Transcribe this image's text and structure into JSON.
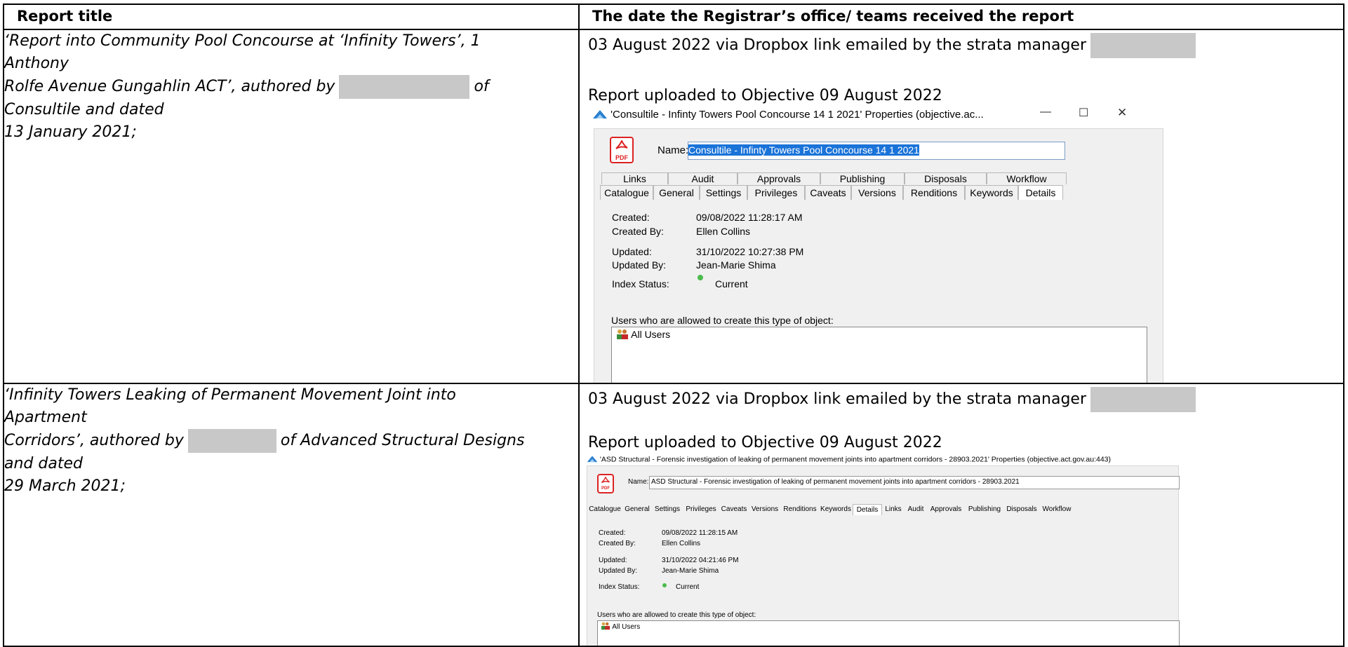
{
  "table": {
    "headers": [
      "Report title",
      "The date the Registrar’s office/ teams received the report"
    ]
  },
  "rows": [
    {
      "title_lines": [
        "‘Report into Community Pool Concourse at ‘Infinity Towers’, 1",
        "Anthony",
        "Rolfe Avenue Gungahlin ACT’, authored by",
        "of",
        "Consultile and dated",
        "13 January 2021;"
      ],
      "received": "03 August 2022 via Dropbox link emailed by the strata manager",
      "uploaded": "Report uploaded to Objective 09 August 2022",
      "props": {
        "window_title": "'Consultile - Infinty Towers Pool Concourse 14 1 2021' Properties (objective.ac...",
        "name_label": "Name:",
        "name_value": "Consultile - Infinty Towers Pool Concourse 14 1 2021",
        "pdf_label": "PDF",
        "tabs_row1": [
          "Links",
          "Audit",
          "Approvals",
          "Publishing",
          "Disposals",
          "Workflow"
        ],
        "tabs_row2": [
          "Catalogue",
          "General",
          "Settings",
          "Privileges",
          "Caveats",
          "Versions",
          "Renditions",
          "Keywords",
          "Details"
        ],
        "active_tab": "Details",
        "created_label": "Created:",
        "created": "09/08/2022 11:28:17 AM",
        "created_by_label": "Created By:",
        "created_by": "Ellen Collins",
        "updated_label": "Updated:",
        "updated": "31/10/2022 10:27:38 PM",
        "updated_by_label": "Updated By:",
        "updated_by": "Jean-Marie Shima",
        "index_status_label": "Index Status:",
        "index_status": "Current",
        "users_label": "Users who are allowed to create this type of object:",
        "users_value": "All Users",
        "minimize": "—",
        "maximize": "☐",
        "close": "✕"
      }
    },
    {
      "title_lines": [
        "‘Infinity Towers Leaking of Permanent Movement Joint into",
        "Apartment",
        "Corridors’, authored by",
        "of Advanced Structural Designs",
        "and dated",
        "29 March 2021;"
      ],
      "received": "03 August 2022 via Dropbox link emailed by the strata manager",
      "uploaded": "Report uploaded to Objective 09 August 2022",
      "props": {
        "window_title": "'ASD Structural - Forensic investigation of leaking of permanent movement joints into apartment corridors - 28903.2021' Properties (objective.act.gov.au:443)",
        "name_label": "Name:",
        "name_value": "ASD Structural - Forensic investigation of leaking of permanent movement joints into apartment corridors - 28903.2021",
        "pdf_label": "PDF",
        "tabs": [
          "Catalogue",
          "General",
          "Settings",
          "Privileges",
          "Caveats",
          "Versions",
          "Renditions",
          "Keywords",
          "Details",
          "Links",
          "Audit",
          "Approvals",
          "Publishing",
          "Disposals",
          "Workflow"
        ],
        "active_tab": "Details",
        "created_label": "Created:",
        "created": "09/08/2022 11:28:15 AM",
        "created_by_label": "Created By:",
        "created_by": "Ellen Collins",
        "updated_label": "Updated:",
        "updated": "31/10/2022 04:21:46 PM",
        "updated_by_label": "Updated By:",
        "updated_by": "Jean-Marie Shima",
        "index_status_label": "Index Status:",
        "index_status": "Current",
        "users_label": "Users who are allowed to create this type of object:",
        "users_value": "All Users"
      }
    }
  ],
  "colors": {
    "border": "#000000",
    "redaction": "#c8c8c8",
    "selection": "#1a73d9",
    "status_dot": "#4cbb4c",
    "pdf_red": "#d22222"
  }
}
